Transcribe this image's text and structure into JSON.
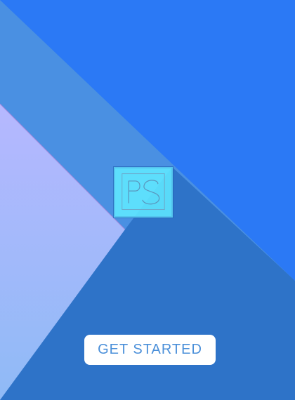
{
  "screen": {
    "colors": {
      "background": "#2a78ee",
      "upper_right_panel": "#2b79f5",
      "diagonal_band": "#4a90e2",
      "lower_panel": "#2e73c8",
      "left_triangle_top": "#b6b8ff",
      "left_triangle_bottom": "#8fbaf6",
      "logo_tile": "#60e8ff",
      "button_background": "#ffffff",
      "button_text": "#4a8fd9"
    },
    "logo": {
      "icon": "ps-monogram-icon"
    },
    "cta": {
      "label": "GET STARTED"
    }
  }
}
